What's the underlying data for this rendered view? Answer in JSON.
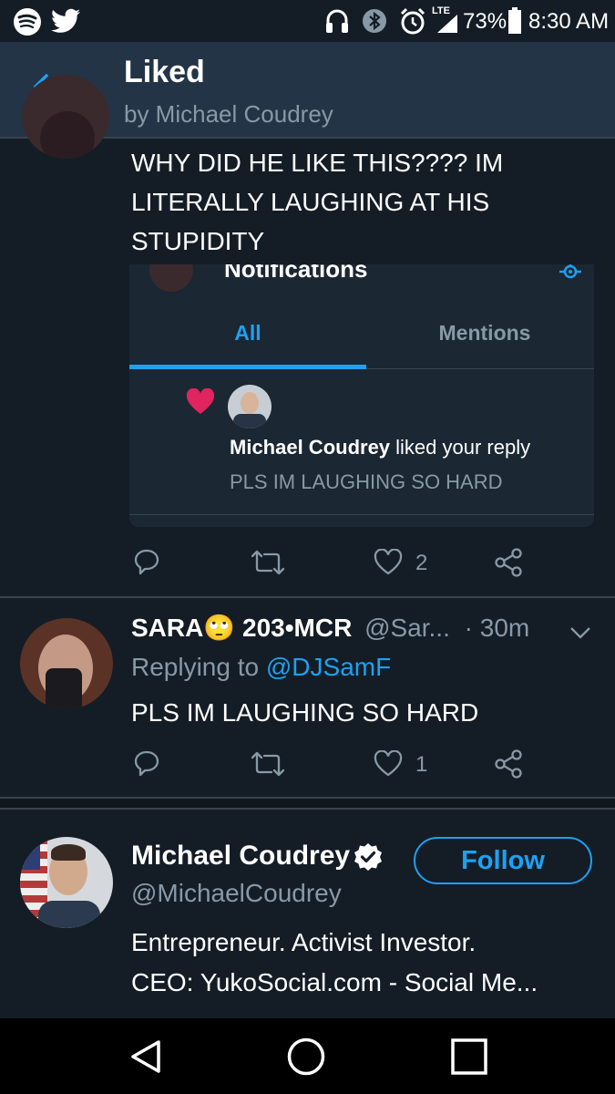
{
  "status_bar": {
    "lte": "LTE",
    "battery": "73%",
    "time": "8:30 AM"
  },
  "header": {
    "title": "Liked",
    "subtitle": "by Michael Coudrey"
  },
  "tweet1": {
    "text_lines": [
      "WHY DID HE LIKE THIS???? IM",
      "LITERALLY LAUGHING AT HIS",
      "STUPIDITY"
    ],
    "embed": {
      "title": "Notifications",
      "tab_all": "All",
      "tab_mentions": "Mentions",
      "liker_name": "Michael Coudrey",
      "liker_action": " liked your reply",
      "reply_text": "PLS IM LAUGHING SO HARD"
    },
    "like_count": "2"
  },
  "tweet2": {
    "name": "SARA",
    "emoji": "🙄",
    "name_suffix": " 203•MCR",
    "handle": "@Sar...",
    "time": "· 30m",
    "replying_label": "Replying to ",
    "replying_handle": "@DJSamF",
    "text": "PLS IM LAUGHING SO HARD",
    "like_count": "1"
  },
  "profile_card": {
    "name": "Michael Coudrey",
    "handle": "@MichaelCoudrey",
    "follow_label": "Follow",
    "bio_line1": "Entrepreneur. Activist Investor.",
    "bio_line2": "CEO: YukoSocial.com - Social Me..."
  },
  "colors": {
    "background": "#141d26",
    "header": "#243447",
    "accent": "#1da1f2",
    "muted": "#8899a6",
    "heart": "#e0245e"
  }
}
